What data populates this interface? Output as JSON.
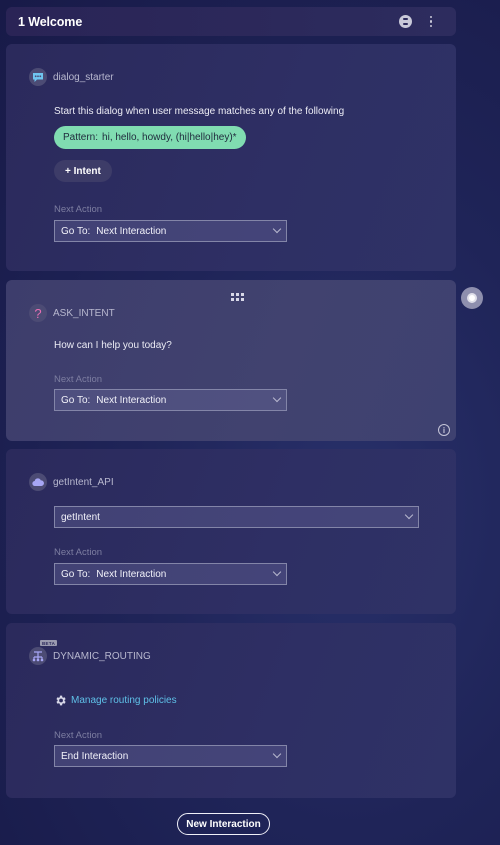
{
  "header": {
    "title": "1 Welcome",
    "icons": [
      "hourglass-icon",
      "more-vertical-icon"
    ]
  },
  "cards": [
    {
      "type": "dialog_starter",
      "icon": "chat-bubble-icon",
      "label": "dialog_starter",
      "description": "Start this dialog when user message matches any of the following",
      "pattern_key": "Pattern:",
      "pattern_value": "hi, hello, howdy, (hi|hello|hey)*",
      "intent_button": "+ Intent",
      "next_action_label": "Next Action",
      "next_action_prefix": "Go To:",
      "next_action_value": "Next Interaction"
    },
    {
      "type": "ask_intent",
      "icon": "question-mark-icon",
      "label": "ASK_INTENT",
      "message": "How can I help you today?",
      "next_action_label": "Next Action",
      "next_action_prefix": "Go To:",
      "next_action_value": "Next Interaction",
      "info_glyph": "i"
    },
    {
      "type": "api",
      "icon": "cloud-icon",
      "label": "getIntent_API",
      "api_select_value": "getIntent",
      "next_action_label": "Next Action",
      "next_action_prefix": "Go To:",
      "next_action_value": "Next Interaction"
    },
    {
      "type": "dynamic_routing",
      "icon": "routing-icon",
      "badge": "BETA",
      "label": "DYNAMIC_ROUTING",
      "manage_link": "Manage routing policies",
      "next_action_label": "Next Action",
      "next_action_value": "End Interaction"
    }
  ],
  "side_button_icon": "record-icon",
  "new_interaction_button": "New Interaction",
  "colors": {
    "pattern_pill": "#80dcb1",
    "link": "#5fc1e8",
    "question_mark": "#e86fb5"
  }
}
